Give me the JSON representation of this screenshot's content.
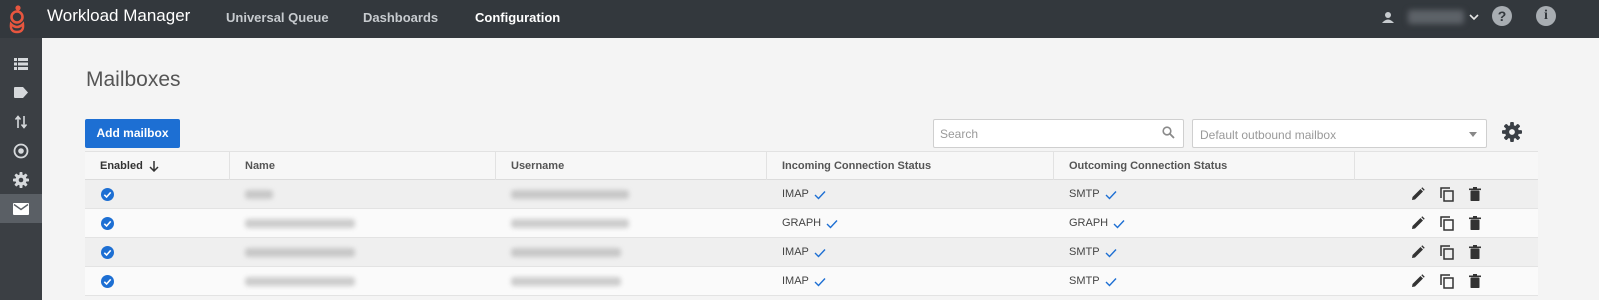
{
  "app": {
    "title": "Workload Manager"
  },
  "nav": [
    {
      "label": "Universal Queue"
    },
    {
      "label": "Dashboards"
    },
    {
      "label": "Configuration"
    }
  ],
  "header_icons": [
    "user-icon",
    "chevron-down-icon",
    "help-icon",
    "info-icon"
  ],
  "sidebar": [
    "list-icon",
    "tag-icon",
    "transfer-icon",
    "target-icon",
    "gear-icon",
    "mail-icon"
  ],
  "page": {
    "title": "Mailboxes"
  },
  "toolbar": {
    "add_label": "Add mailbox",
    "search_placeholder": "Search",
    "outbound_placeholder": "Default outbound mailbox"
  },
  "table": {
    "headers": {
      "enabled": "Enabled",
      "name": "Name",
      "username": "Username",
      "incoming": "Incoming Connection Status",
      "outgoing": "Outcoming Connection Status"
    },
    "rows": [
      {
        "enabled": true,
        "incoming": "IMAP",
        "outgoing": "SMTP"
      },
      {
        "enabled": true,
        "incoming": "GRAPH",
        "outgoing": "GRAPH"
      },
      {
        "enabled": true,
        "incoming": "IMAP",
        "outgoing": "SMTP"
      },
      {
        "enabled": true,
        "incoming": "IMAP",
        "outgoing": "SMTP"
      }
    ]
  },
  "colors": {
    "accent": "#1d6fd3",
    "topbar": "#33383d",
    "sidebar": "#3b3f44",
    "logo": "#e8563f"
  }
}
